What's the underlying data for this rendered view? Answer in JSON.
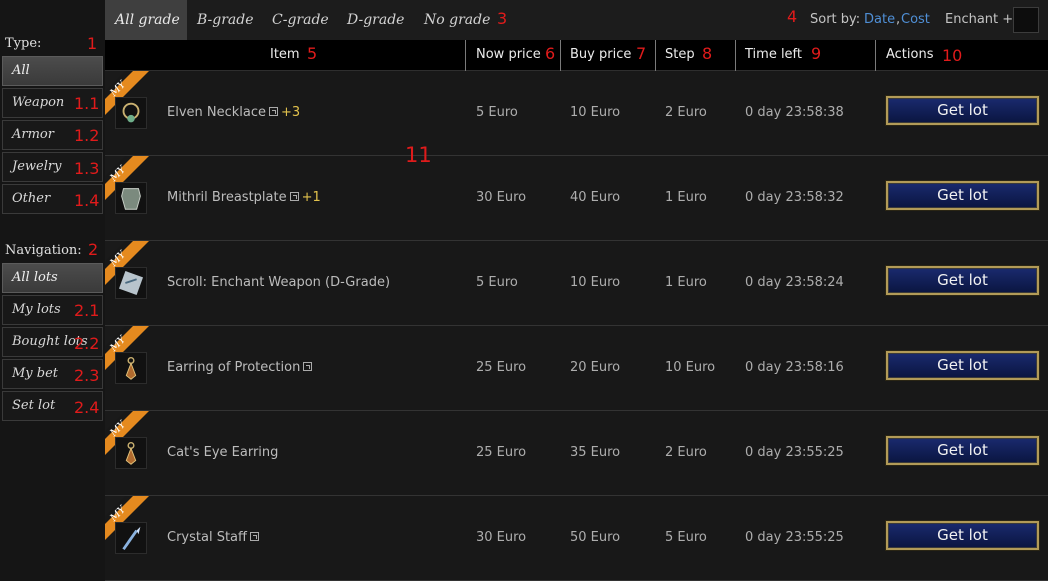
{
  "sidebar": {
    "type_heading": "Type:",
    "type_items": [
      "All",
      "Weapon",
      "Armor",
      "Jewelry",
      "Other"
    ],
    "nav_heading": "Navigation:",
    "nav_items": [
      "All lots",
      "My lots",
      "Bought lots",
      "My bet",
      "Set lot"
    ]
  },
  "grades": [
    "All grade",
    "B-grade",
    "C-grade",
    "D-grade",
    "No grade"
  ],
  "sort": {
    "label": "Sort by:",
    "date": "Date",
    "separator": ",",
    "cost": "Cost"
  },
  "enchant": {
    "label": "Enchant +"
  },
  "columns": {
    "item": "Item",
    "now_price": "Now price",
    "buy_price": "Buy price",
    "step": "Step",
    "time_left": "Time left",
    "actions": "Actions"
  },
  "ribbon_label": "MY",
  "rows": [
    {
      "name": "Elven Necklace",
      "enchant": "+3",
      "now": "5 Euro",
      "buy": "10 Euro",
      "step": "2 Euro",
      "time": "0 day 23:58:38",
      "action": "Get lot",
      "icon": "necklace-icon"
    },
    {
      "name": "Mithril Breastplate",
      "enchant": "+1",
      "now": "30 Euro",
      "buy": "40 Euro",
      "step": "1 Euro",
      "time": "0 day 23:58:32",
      "action": "Get lot",
      "icon": "breastplate-icon"
    },
    {
      "name": "Scroll: Enchant Weapon (D-Grade)",
      "enchant": "",
      "now": "5 Euro",
      "buy": "10 Euro",
      "step": "1 Euro",
      "time": "0 day 23:58:24",
      "action": "Get lot",
      "icon": "scroll-icon"
    },
    {
      "name": "Earring of Protection",
      "enchant": "",
      "now": "25 Euro",
      "buy": "20 Euro",
      "step": "10 Euro",
      "time": "0 day 23:58:16",
      "action": "Get lot",
      "icon": "earring-icon"
    },
    {
      "name": "Cat's Eye Earring",
      "enchant": "",
      "now": "25 Euro",
      "buy": "35 Euro",
      "step": "2 Euro",
      "time": "0 day 23:55:25",
      "action": "Get lot",
      "icon": "earring-icon"
    },
    {
      "name": "Crystal Staff",
      "enchant": "",
      "now": "30 Euro",
      "buy": "50 Euro",
      "step": "5 Euro",
      "time": "0 day 23:55:25",
      "action": "Get lot",
      "icon": "staff-icon"
    }
  ],
  "markers": [
    "1",
    "1.1",
    "1.2",
    "1.3",
    "1.4",
    "2",
    "2.1",
    "2.2",
    "2.3",
    "2.4",
    "3",
    "4",
    "5",
    "6",
    "7",
    "8",
    "9",
    "10",
    "11"
  ],
  "colors": {
    "marker": "#e01b1b",
    "link": "#4f8fd6",
    "ribbon": "#e58a1f",
    "enchant": "#e2c24d",
    "button": "#0f1d55",
    "button_border": "#b29b58"
  }
}
